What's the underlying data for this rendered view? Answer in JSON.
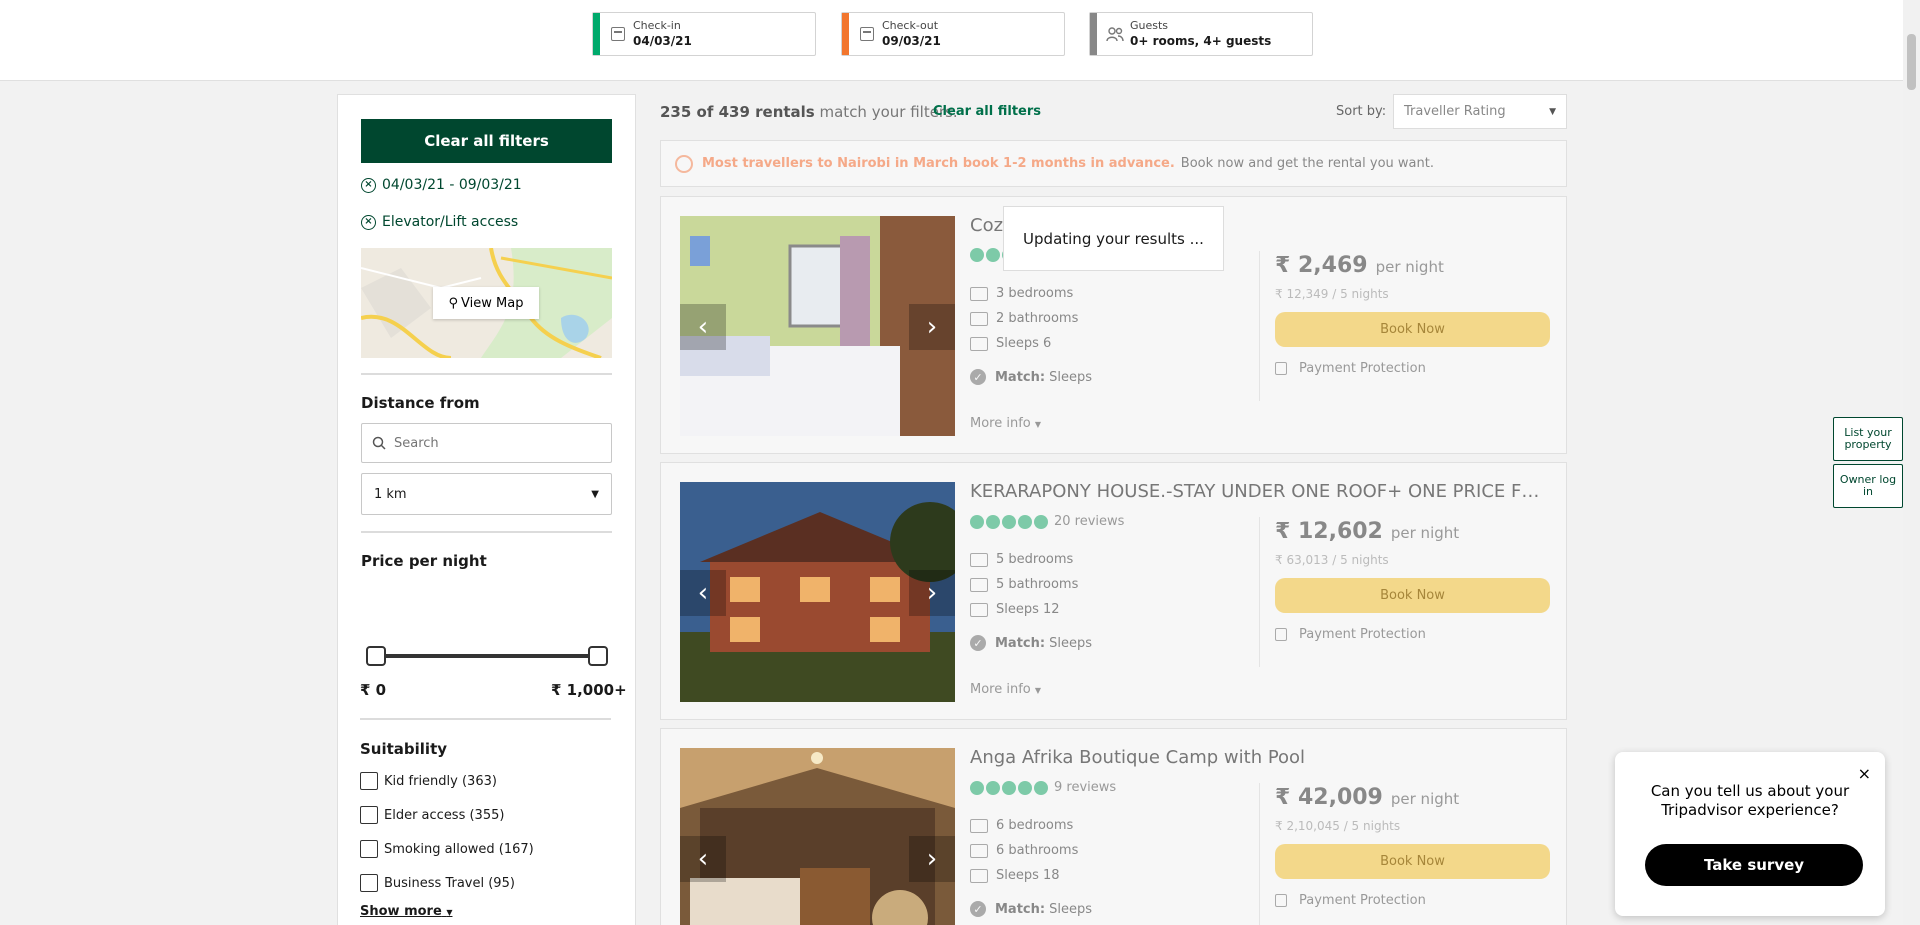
{
  "search_bar": {
    "checkin_label": "Check-in",
    "checkin_value": "04/03/21",
    "checkout_label": "Check-out",
    "checkout_value": "09/03/21",
    "guests_label": "Guests",
    "guests_value": "0+ rooms, 4+ guests",
    "checkin_color": "#00aa6c",
    "checkout_color": "#f2762e",
    "guests_color": "#888888"
  },
  "sidebar": {
    "clear_button": "Clear all filters",
    "active_filters": [
      "04/03/21 - 09/03/21",
      "Elevator/Lift access"
    ],
    "map_button": "View Map",
    "distance_title": "Distance from",
    "distance_search_placeholder": "Search",
    "distance_select": "1 km",
    "price_title": "Price per night",
    "price_min": "₹ 0",
    "price_max": "₹ 1,000+",
    "suitability_title": "Suitability",
    "suitability_options": [
      "Kid friendly (363)",
      "Elder access (355)",
      "Smoking allowed (167)",
      "Business Travel (95)"
    ],
    "show_more": "Show more"
  },
  "results": {
    "count_bold": "235 of 439 rentals",
    "count_rest": " match your filters.",
    "clear_link": "Clear all filters",
    "sort_label": "Sort by:",
    "sort_value": "Traveller Rating"
  },
  "banner": {
    "warning": "Most travellers to Nairobi in March book 1-2 months in advance.",
    "message": "Book now and get the rental you want."
  },
  "loading_text": "Updating your results ...",
  "listings": [
    {
      "title": "Cozy Nairobi Ne...",
      "reviews": "",
      "bedrooms": "3 bedrooms",
      "bathrooms": "2 bathrooms",
      "sleeps": "Sleeps 6",
      "match_label": "Match:",
      "match_value": "Sleeps",
      "more_info": "More info",
      "price": "₹ 2,469",
      "per_night": "per night",
      "total": "₹ 12,349 / 5 nights",
      "book": "Book Now",
      "protection": "Payment Protection"
    },
    {
      "title": "KERARAPONY HOUSE.-STAY UNDER ONE ROOF+ ONE PRICE FO...",
      "reviews": "20 reviews",
      "bedrooms": "5 bedrooms",
      "bathrooms": "5 bathrooms",
      "sleeps": "Sleeps 12",
      "match_label": "Match:",
      "match_value": "Sleeps",
      "more_info": "More info",
      "price": "₹ 12,602",
      "per_night": "per night",
      "total": "₹ 63,013 / 5 nights",
      "book": "Book Now",
      "protection": "Payment Protection"
    },
    {
      "title": "Anga Afrika Boutique Camp with Pool",
      "reviews": "9 reviews",
      "bedrooms": "6 bedrooms",
      "bathrooms": "6 bathrooms",
      "sleeps": "Sleeps 18",
      "match_label": "Match:",
      "match_value": "Sleeps",
      "more_info": "More info",
      "price": "₹ 42,009",
      "per_night": "per night",
      "total": "₹ 2,10,045 / 5 nights",
      "book": "Book Now",
      "protection": "Payment Protection"
    }
  ],
  "side_tabs": {
    "list_property": "List your property",
    "owner_login": "Owner log in"
  },
  "survey": {
    "question": "Can you tell us about your Tripadvisor experience?",
    "button": "Take survey",
    "close": "×"
  }
}
